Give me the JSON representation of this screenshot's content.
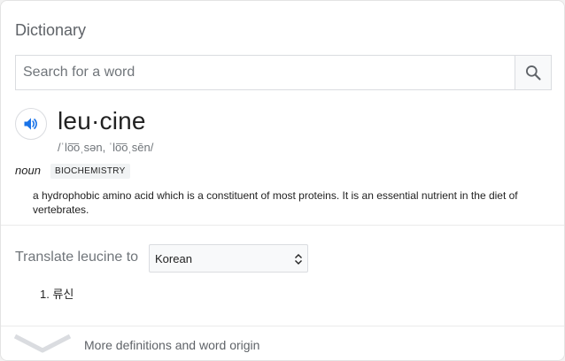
{
  "dictionary": {
    "title": "Dictionary",
    "search": {
      "placeholder": "Search for a word",
      "value": "",
      "icon": "search-icon"
    },
    "entry": {
      "audio_icon": "speaker-icon",
      "word": "leu·cine",
      "phonetic": "/ˈlo͞oˌsən, ˈlo͞oˌsēn/",
      "part_of_speech": "noun",
      "label": "BIOCHEMISTRY",
      "definition": "a hydrophobic amino acid which is a constituent of most proteins. It is an essential nutrient in the diet of vertebrates."
    },
    "translate": {
      "label": "Translate leucine to",
      "selected_language": "Korean",
      "results": [
        "1. 류신"
      ]
    },
    "footer": {
      "icon": "chevron-down-icon",
      "text": "More definitions and word origin"
    }
  }
}
